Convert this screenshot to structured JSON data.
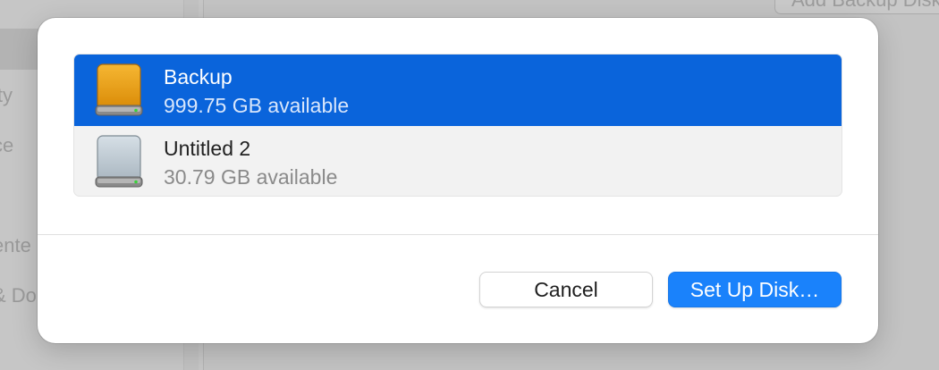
{
  "background": {
    "sidebar_fragments": [
      "ity",
      "ce",
      "ente",
      "& Do"
    ],
    "add_button_label": "Add Backup Disk..."
  },
  "dialog": {
    "disks": [
      {
        "name": "Backup",
        "available": "999.75 GB available",
        "icon": "orange-external-drive-icon",
        "selected": true
      },
      {
        "name": "Untitled 2",
        "available": "30.79 GB available",
        "icon": "gray-external-drive-icon",
        "selected": false
      }
    ],
    "cancel_label": "Cancel",
    "setup_label": "Set Up Disk…"
  },
  "colors": {
    "selection": "#0a64db",
    "primary_button": "#1a82fb",
    "drive_orange": "#e89a10",
    "drive_gray": "#b9c5ce"
  }
}
